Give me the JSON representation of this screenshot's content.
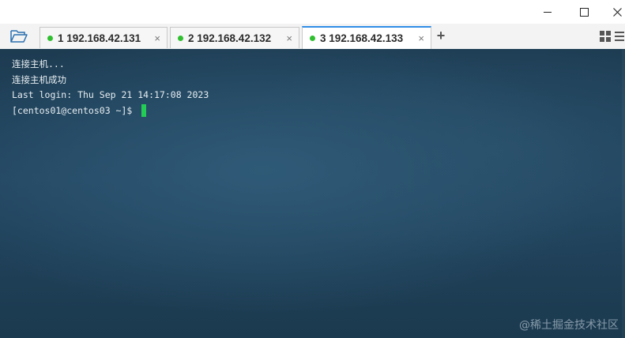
{
  "window": {
    "controls": {
      "minimize_icon": "minimize-icon",
      "maximize_icon": "maximize-icon",
      "close_icon": "close-icon"
    }
  },
  "toolbar": {
    "open_icon": "folder-open-icon"
  },
  "tabs": [
    {
      "label": "1 192.168.42.131",
      "status_color": "#2fbf2f",
      "active": false,
      "close": "×"
    },
    {
      "label": "2 192.168.42.132",
      "status_color": "#2fbf2f",
      "active": false,
      "close": "×"
    },
    {
      "label": "3 192.168.42.133",
      "status_color": "#2fbf2f",
      "active": true,
      "close": "×"
    }
  ],
  "new_tab": "+",
  "layout_icons": [
    "grid-layout-icon",
    "list-layout-icon"
  ],
  "terminal": {
    "lines": [
      "连接主机...",
      "连接主机成功",
      "Last login: Thu Sep 21 14:17:08 2023",
      "[centos01@centos03 ~]$ "
    ],
    "cursor_color": "#22cc55"
  },
  "watermark": "@稀土掘金技术社区",
  "colors": {
    "accent": "#2f8ee6",
    "status": "#2fbf2f"
  }
}
